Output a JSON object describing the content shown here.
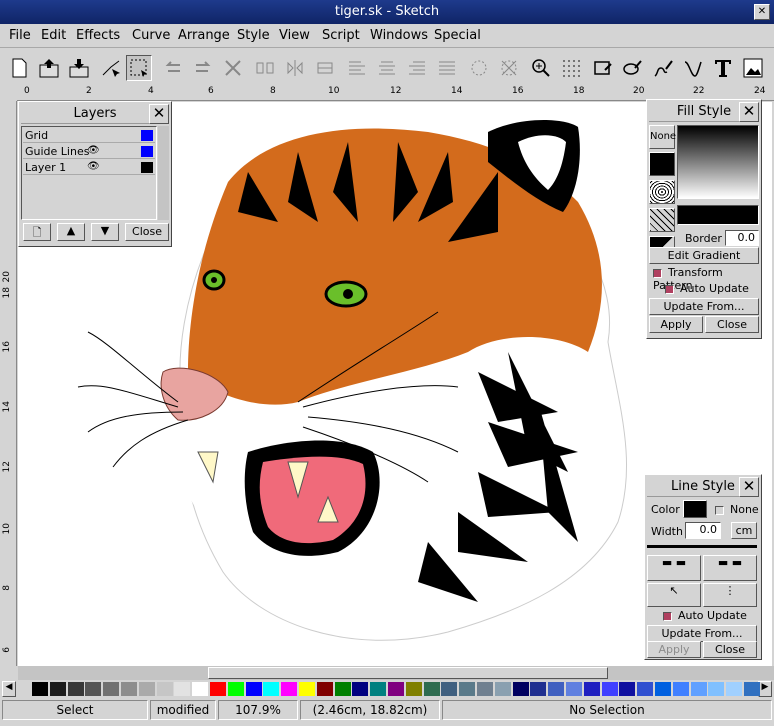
{
  "window": {
    "title": "tiger.sk - Sketch"
  },
  "menu": [
    "File",
    "Edit",
    "Effects",
    "Curve",
    "Arrange",
    "Style",
    "View",
    "Script",
    "Windows",
    "Special"
  ],
  "ruler": {
    "h": [
      "0",
      "2",
      "4",
      "6",
      "8",
      "10",
      "12",
      "14",
      "16",
      "18",
      "20",
      "22",
      "24"
    ],
    "v": [
      "20",
      "18",
      "16",
      "14",
      "12",
      "10",
      "8",
      "6"
    ]
  },
  "layers": {
    "title": "Layers",
    "rows": [
      "Grid",
      "Guide Lines",
      "Layer 1"
    ],
    "close_label": "Close"
  },
  "fill": {
    "title": "Fill Style",
    "none_label": "None",
    "border_label": "Border",
    "border_value": "0.0",
    "edit_gradient": "Edit Gradient",
    "transform_pattern": "Transform Pattern",
    "auto_update": "Auto Update",
    "update_from": "Update From...",
    "apply": "Apply",
    "close": "Close"
  },
  "line": {
    "title": "Line Style",
    "color_label": "Color",
    "none_label": "None",
    "width_label": "Width",
    "width_value": "0.0",
    "unit": "cm",
    "auto_update": "Auto Update",
    "update_from": "Update From...",
    "apply": "Apply",
    "close": "Close"
  },
  "palette": [
    "#000000",
    "#1c1c1c",
    "#383838",
    "#555555",
    "#717171",
    "#8d8d8d",
    "#aaaaaa",
    "#c6c6c6",
    "#e2e2e2",
    "#ffffff",
    "#ff0000",
    "#00ff00",
    "#0000ff",
    "#00ffff",
    "#ff00ff",
    "#ffff00",
    "#800000",
    "#008000",
    "#000080",
    "#008080",
    "#800080",
    "#808000",
    "#2e6b4f",
    "#406080",
    "#5a7a8a",
    "#708090",
    "#8aa0b0",
    "#000060",
    "#203090",
    "#4060c0",
    "#6080e0",
    "#2020c0",
    "#4040ff",
    "#1010a0",
    "#3050d0",
    "#0060e0",
    "#4080ff",
    "#60a0ff",
    "#80c0ff",
    "#a0d0ff",
    "#3070c0"
  ],
  "status": {
    "mode": "Select",
    "state": "modified",
    "zoom": "107.9%",
    "coords": "(2.46cm, 18.82cm)",
    "selection": "No Selection"
  }
}
